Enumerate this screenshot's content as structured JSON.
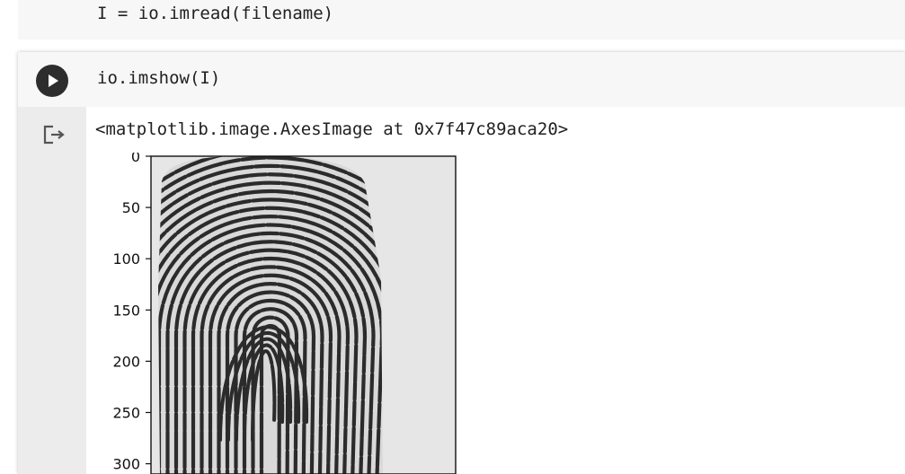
{
  "previous_cell": {
    "code": "I = io.imread(filename)"
  },
  "cell": {
    "run_button": "run-cell",
    "code": "io.imshow(I)",
    "output_text": "<matplotlib.image.AxesImage at 0x7f47c89aca20>"
  },
  "chart_data": {
    "type": "image",
    "ylabel": "",
    "xlabel": "",
    "yticks": [
      "0",
      "50",
      "100",
      "150",
      "200",
      "250",
      "300"
    ],
    "ytick_values": [
      0,
      50,
      100,
      150,
      200,
      250,
      300
    ]
  }
}
